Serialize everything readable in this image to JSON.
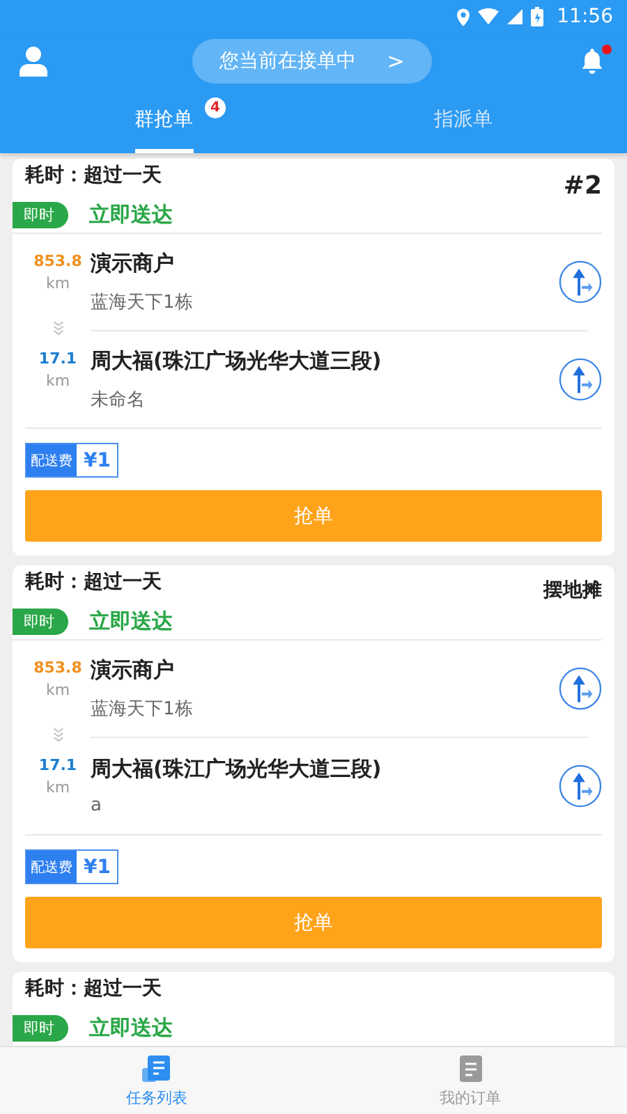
{
  "status_bar": {
    "time": "11:56"
  },
  "header": {
    "status_pill": "您当前在接单中",
    "chevron": ">",
    "notification_dot": true
  },
  "tabs": [
    {
      "label": "群抢单",
      "selected": true,
      "badge": "4"
    },
    {
      "label": "指派单",
      "selected": false
    }
  ],
  "orders": [
    {
      "elapsed": "耗时：超过一天",
      "corner": {
        "kind": "number",
        "text": "#2"
      },
      "tag": "即时",
      "delivery": "立即送达",
      "stops": [
        {
          "kind": "pickup",
          "distance": "853.8",
          "unit": "km",
          "name": "演示商户",
          "address": "蓝海天下1栋"
        },
        {
          "kind": "dropoff",
          "distance": "17.1",
          "unit": "km",
          "name": "周大福(珠江广场光华大道三段)",
          "address": "未命名"
        }
      ],
      "fee_label": "配送费",
      "fee": "¥1",
      "button": "抢单"
    },
    {
      "elapsed": "耗时：超过一天",
      "corner": {
        "kind": "text",
        "text": "摆地摊"
      },
      "tag": "即时",
      "delivery": "立即送达",
      "stops": [
        {
          "kind": "pickup",
          "distance": "853.8",
          "unit": "km",
          "name": "演示商户",
          "address": "蓝海天下1栋"
        },
        {
          "kind": "dropoff",
          "distance": "17.1",
          "unit": "km",
          "name": "周大福(珠江广场光华大道三段)",
          "address": "a"
        }
      ],
      "fee_label": "配送费",
      "fee": "¥1",
      "button": "抢单"
    },
    {
      "elapsed": "耗时：超过一天",
      "tag": "即时",
      "delivery": "立即送达"
    }
  ],
  "bottom_nav": [
    {
      "label": "任务列表",
      "selected": true
    },
    {
      "label": "我的订单",
      "selected": false
    }
  ]
}
